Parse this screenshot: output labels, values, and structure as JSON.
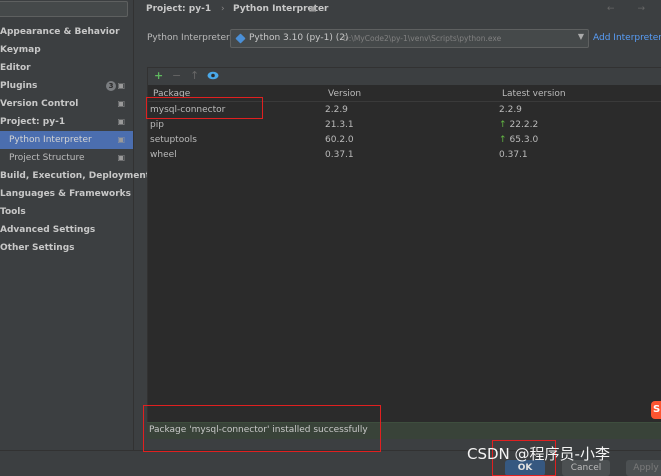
{
  "sidebar": {
    "items": [
      {
        "label": "Appearance & Behavior",
        "bold": true
      },
      {
        "label": "Keymap",
        "bold": true
      },
      {
        "label": "Editor",
        "bold": true
      },
      {
        "label": "Plugins",
        "bold": true,
        "badge": "3",
        "mark": "▣"
      },
      {
        "label": "Version Control",
        "bold": true,
        "mark": "▣"
      },
      {
        "label": "Project: py-1",
        "bold": true,
        "mark": "▣"
      },
      {
        "label": "Python Interpreter",
        "child": true,
        "selected": true,
        "mark": "▣"
      },
      {
        "label": "Project Structure",
        "child": true,
        "mark": "▣"
      },
      {
        "label": "Build, Execution, Deployment",
        "bold": true
      },
      {
        "label": "Languages & Frameworks",
        "bold": true
      },
      {
        "label": "Tools",
        "bold": true
      },
      {
        "label": "Advanced Settings",
        "bold": true
      },
      {
        "label": "Other Settings",
        "bold": true
      }
    ]
  },
  "header": {
    "breadcrumb_project": "Project: py-1",
    "breadcrumb_separator": "›",
    "breadcrumb_page": "Python Interpreter",
    "mark": "▣",
    "nav_arrows": "← →"
  },
  "interpreter": {
    "label": "Python Interpreter:",
    "selected_name": "Python 3.10 (py-1) (2)",
    "selected_path": "D:\\MyCode2\\py-1\\venv\\Scripts\\python.exe",
    "add_link": "Add Interpreter"
  },
  "toolbar": {
    "add_glyph": "+",
    "remove_glyph": "−",
    "upgrade_glyph": "↑"
  },
  "table": {
    "columns": [
      "Package",
      "Version",
      "Latest version"
    ],
    "rows": [
      {
        "package": "mysql-connector",
        "version": "2.2.9",
        "latest": "2.2.9",
        "upgrade": false
      },
      {
        "package": "pip",
        "version": "21.3.1",
        "latest": "22.2.2",
        "upgrade": true
      },
      {
        "package": "setuptools",
        "version": "60.2.0",
        "latest": "65.3.0",
        "upgrade": true
      },
      {
        "package": "wheel",
        "version": "0.37.1",
        "latest": "0.37.1",
        "upgrade": false
      }
    ]
  },
  "status": {
    "message": "Package 'mysql-connector' installed successfully"
  },
  "buttons": {
    "ok": "OK",
    "cancel": "Cancel",
    "apply": "Apply"
  },
  "watermark": "CSDN @程序员-小李",
  "csdn_logo": "S",
  "colors": {
    "accent": "#4b6eaf",
    "link": "#589df6",
    "upgrade_arrow": "#62b543",
    "annotation": "#e02020"
  }
}
